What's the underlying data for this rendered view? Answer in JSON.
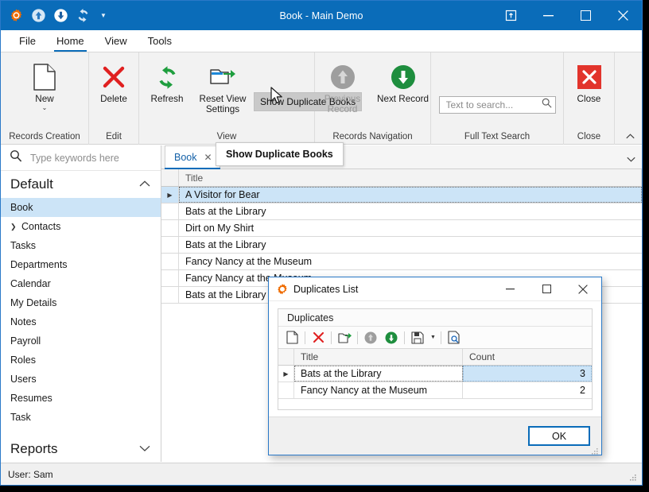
{
  "window": {
    "title": "Book - Main Demo",
    "quick_access": [
      "app-logo-icon",
      "upload-icon",
      "download-icon",
      "refresh-icon",
      "qat-dropdown-icon"
    ],
    "buttons": {
      "ribbon_display": "Ribbon Display Options",
      "minimize": "Minimize",
      "restore": "Restore Down",
      "close": "Close"
    }
  },
  "ribbon": {
    "tabs": [
      {
        "label": "File",
        "active": false
      },
      {
        "label": "Home",
        "active": true
      },
      {
        "label": "View",
        "active": false
      },
      {
        "label": "Tools",
        "active": false
      }
    ],
    "collapse_icon": "chevron-up-icon",
    "groups": [
      {
        "label": "Records Creation",
        "buttons": [
          {
            "label": "New",
            "icon": "new-document-icon",
            "dropdown": true,
            "disabled": false
          }
        ]
      },
      {
        "label": "Edit",
        "buttons": [
          {
            "label": "Delete",
            "icon": "red-x-icon",
            "disabled": false
          }
        ]
      },
      {
        "label": "View",
        "buttons": [
          {
            "label": "Refresh",
            "icon": "green-refresh-icon",
            "disabled": false
          },
          {
            "label": "Reset View Settings",
            "icon": "reset-view-icon",
            "disabled": false
          }
        ],
        "toggle_button": {
          "label": "Show Duplicate Books",
          "pressed": true
        }
      },
      {
        "label": "Records Navigation",
        "buttons": [
          {
            "label": "Previous Record",
            "icon": "gray-up-arrow-circle-icon",
            "disabled": true
          },
          {
            "label": "Next Record",
            "icon": "green-down-arrow-circle-icon",
            "disabled": false
          }
        ]
      },
      {
        "label": "Full Text Search",
        "search": {
          "value": "",
          "placeholder": "Text to search...",
          "icon": "search-icon"
        }
      },
      {
        "label": "Close",
        "buttons": [
          {
            "label": "Close",
            "icon": "red-close-box-icon",
            "disabled": false
          }
        ]
      }
    ]
  },
  "sidebar": {
    "search": {
      "value": "",
      "placeholder": "Type keywords here",
      "icon": "search-icon"
    },
    "groups": [
      {
        "label": "Default",
        "expanded": true,
        "chevron": "chevron-up-icon",
        "items": [
          {
            "label": "Book",
            "selected": true,
            "expandable": false
          },
          {
            "label": "Contacts",
            "selected": false,
            "expandable": true
          },
          {
            "label": "Tasks",
            "selected": false,
            "expandable": false
          },
          {
            "label": "Departments",
            "selected": false,
            "expandable": false
          },
          {
            "label": "Calendar",
            "selected": false,
            "expandable": false
          },
          {
            "label": "My Details",
            "selected": false,
            "expandable": false
          },
          {
            "label": "Notes",
            "selected": false,
            "expandable": false
          },
          {
            "label": "Payroll",
            "selected": false,
            "expandable": false
          },
          {
            "label": "Roles",
            "selected": false,
            "expandable": false
          },
          {
            "label": "Users",
            "selected": false,
            "expandable": false
          },
          {
            "label": "Resumes",
            "selected": false,
            "expandable": false
          },
          {
            "label": "Task",
            "selected": false,
            "expandable": false
          }
        ]
      },
      {
        "label": "Reports",
        "expanded": false,
        "chevron": "chevron-down-icon",
        "items": []
      }
    ]
  },
  "document": {
    "tabs": [
      {
        "label": "Book",
        "active": true,
        "close_icon": "close-icon"
      }
    ],
    "tabstrip_caret": "chevron-down-icon",
    "tooltip": "Show Duplicate Books",
    "grid": {
      "columns": [
        "Title"
      ],
      "rows": [
        {
          "title": "A Visitor for Bear",
          "selected": true
        },
        {
          "title": "Bats at the Library",
          "selected": false
        },
        {
          "title": "Dirt on My Shirt",
          "selected": false
        },
        {
          "title": "Bats at the Library",
          "selected": false
        },
        {
          "title": "Fancy Nancy at the Museum",
          "selected": false
        },
        {
          "title": "Fancy Nancy at the Museum",
          "selected": false
        },
        {
          "title": "Bats at the Library",
          "selected": false
        }
      ]
    }
  },
  "dialog": {
    "title": "Duplicates List",
    "icon": "gear-icon",
    "buttons": {
      "minimize": "Minimize",
      "maximize": "Maximize",
      "close": "Close"
    },
    "panel_caption": "Duplicates",
    "toolbar": [
      {
        "name": "new-record-icon",
        "label": "New"
      },
      {
        "name": "delete-record-icon",
        "label": "Delete"
      },
      {
        "name": "open-record-icon",
        "label": "Open"
      },
      {
        "name": "previous-record-icon",
        "label": "Previous Record",
        "disabled": true
      },
      {
        "name": "next-record-icon",
        "label": "Next Record",
        "disabled": false
      },
      {
        "name": "export-icon",
        "label": "Export",
        "dropdown": true
      },
      {
        "name": "print-preview-icon",
        "label": "Print Preview"
      }
    ],
    "grid": {
      "columns": [
        "Title",
        "Count"
      ],
      "rows": [
        {
          "title": "Bats at the Library",
          "count": "3",
          "selected": true
        },
        {
          "title": "Fancy Nancy at the Museum",
          "count": "2",
          "selected": false
        }
      ]
    },
    "ok_label": "OK"
  },
  "statusbar": {
    "text": "User: Sam"
  }
}
